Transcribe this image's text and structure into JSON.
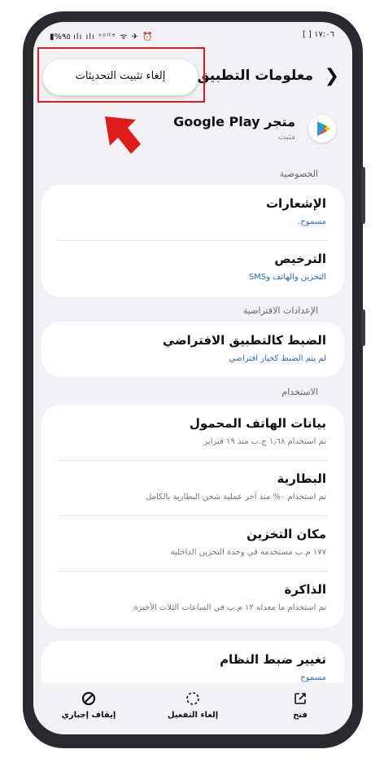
{
  "status_bar": {
    "left": "▮%٩٥ ılı ılı ᵛᵒˡᵗᵉ ᯤ ✈ ⏰",
    "right": "⠀[ ] ١٧:٠٦"
  },
  "header": {
    "title": "معلومات التطبيق",
    "back_icon": "chevron-left-icon"
  },
  "popup": {
    "label": "إلغاء تثبيت التحديثات"
  },
  "app": {
    "name": "متجر Google Play",
    "status": "مثبت"
  },
  "sections": {
    "privacy": "الخصوصية",
    "defaults": "الإعدادات الافتراضية",
    "usage": "الاستخدام"
  },
  "privacy_items": [
    {
      "title": "الإشعارات",
      "subtitle": "مسموح."
    },
    {
      "title": "الترخيص",
      "subtitle": "التخزين والهاتف وSMS"
    }
  ],
  "default_items": [
    {
      "title": "الضبط كالتطبيق الافتراضي",
      "subtitle": "لم يتم الضبط كخيار افتراضي"
    }
  ],
  "usage_items": [
    {
      "title": "بيانات الهاتف المحمول",
      "subtitle": "تم استخدام ١٫٦٨ ج.ب منذ ١٩ فبراير"
    },
    {
      "title": "البطارية",
      "subtitle": "تم استخدام ٠% منذ آخر عملية شحن البطارية بالكامل"
    },
    {
      "title": "مكان التخزين",
      "subtitle": "١٧٧ م.ب مستخدمة في وحدة التخزين الداخلية"
    },
    {
      "title": "الذاكرة",
      "subtitle": "تم استخدام ما معدله ١٢ م.ب في الساعات الثلاث الأخيرة"
    }
  ],
  "system_item": {
    "title": "تغيير ضبط النظام",
    "subtitle": "مسموح"
  },
  "bottom_bar": [
    {
      "label": "فتح",
      "icon": "open-icon"
    },
    {
      "label": "إلغاء التفعيل",
      "icon": "disable-icon"
    },
    {
      "label": "إيقاف إجباري",
      "icon": "force-stop-icon"
    }
  ],
  "colors": {
    "accent_blue": "#2a6ad8",
    "highlight_red": "#e01b1b"
  }
}
